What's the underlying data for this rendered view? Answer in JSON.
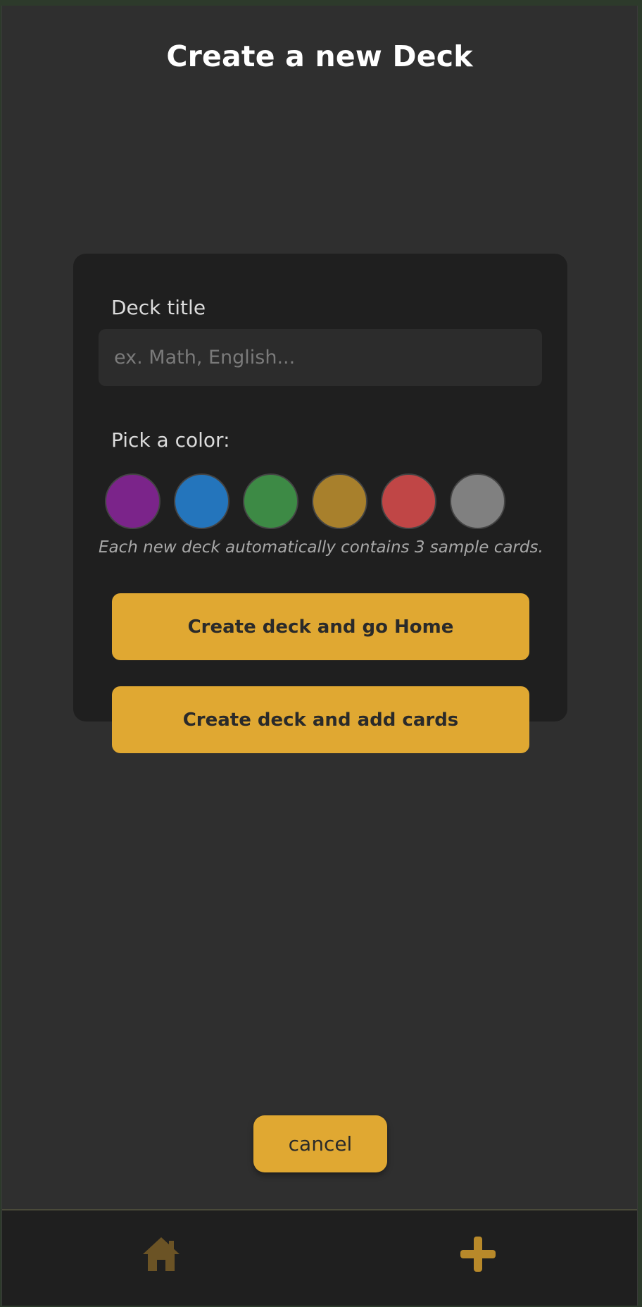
{
  "header": {
    "title": "Create a new Deck"
  },
  "form": {
    "deck_title_label": "Deck title",
    "deck_title_value": "",
    "deck_title_placeholder": "ex. Math, English...",
    "color_label": "Pick a color:",
    "colors": [
      {
        "name": "purple",
        "hex": "#7b248a"
      },
      {
        "name": "blue",
        "hex": "#2475bc"
      },
      {
        "name": "green",
        "hex": "#3d8a45"
      },
      {
        "name": "gold",
        "hex": "#a8802c"
      },
      {
        "name": "red",
        "hex": "#c04646"
      },
      {
        "name": "gray",
        "hex": "#808080"
      }
    ],
    "note": "Each new deck automatically contains 3 sample cards.",
    "create_home_label": "Create deck and go Home",
    "create_add_cards_label": "Create deck and add cards"
  },
  "cancel_label": "cancel",
  "nav": {
    "items": [
      {
        "icon": "home-icon",
        "color": "#6b5325"
      },
      {
        "icon": "plus-icon",
        "color": "#b8892a"
      }
    ]
  },
  "theme": {
    "accent": "#e0a832",
    "card_bg": "#1f1f1f",
    "page_bg": "#2f2f2f"
  }
}
